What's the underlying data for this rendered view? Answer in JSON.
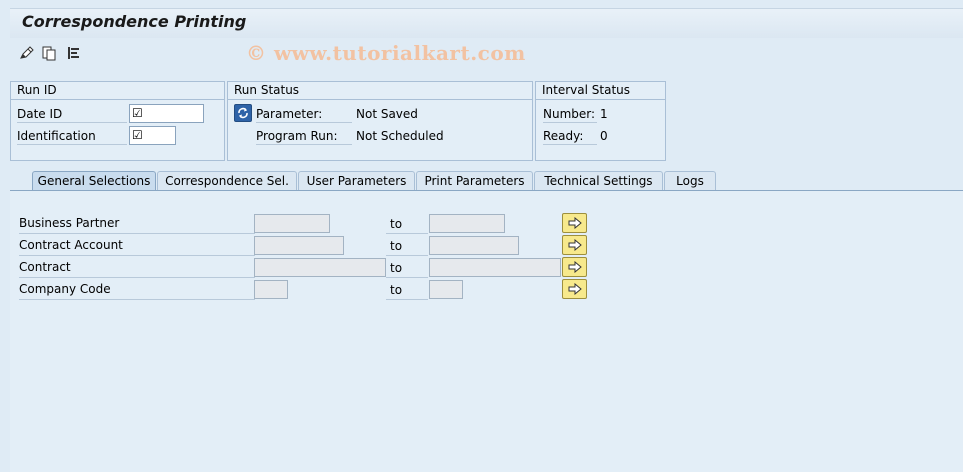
{
  "header": {
    "title": "Correspondence Printing",
    "watermark": "© www.tutorialkart.com"
  },
  "toolbar": {
    "icons": [
      "edit-pencil-icon",
      "copy-icon",
      "list-icon"
    ]
  },
  "run_id": {
    "title": "Run ID",
    "date_id_label": "Date ID",
    "date_id_value": "☑",
    "identification_label": "Identification",
    "identification_value": "☑"
  },
  "run_status": {
    "title": "Run Status",
    "parameter_label": "Parameter:",
    "parameter_value": "Not Saved",
    "program_run_label": "Program Run:",
    "program_run_value": "Not Scheduled"
  },
  "interval_status": {
    "title": "Interval Status",
    "number_label": "Number:",
    "number_value": "1",
    "ready_label": "Ready:",
    "ready_value": "0"
  },
  "tabs": [
    {
      "label": "General Selections",
      "active": true
    },
    {
      "label": "Correspondence Sel.",
      "active": false
    },
    {
      "label": "User Parameters",
      "active": false
    },
    {
      "label": "Print Parameters",
      "active": false
    },
    {
      "label": "Technical Settings",
      "active": false
    },
    {
      "label": "Logs",
      "active": false
    }
  ],
  "selections": {
    "to_label": "to",
    "rows": [
      {
        "label": "Business Partner",
        "from": "",
        "to": ""
      },
      {
        "label": "Contract Account",
        "from": "",
        "to": ""
      },
      {
        "label": "Contract",
        "from": "",
        "to": ""
      },
      {
        "label": "Company Code",
        "from": "",
        "to": ""
      }
    ]
  }
}
